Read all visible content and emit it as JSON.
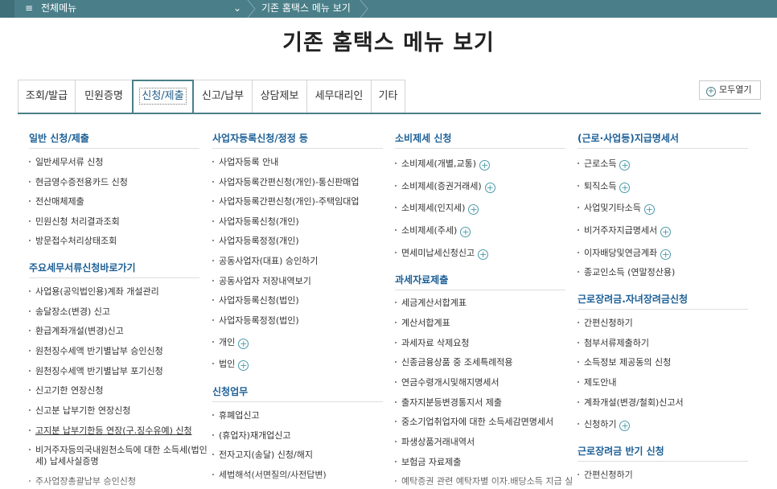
{
  "topbar": {
    "hamburger": "≡",
    "menu_all": "전체메뉴",
    "chevron": "⌄",
    "breadcrumb": "기존 홈택스 메뉴 보기"
  },
  "page_title": "기존 홈택스 메뉴 보기",
  "tabs": [
    {
      "label": "조회/발급"
    },
    {
      "label": "민원증명"
    },
    {
      "label": "신청/제출",
      "active": true
    },
    {
      "label": "신고/납부"
    },
    {
      "label": "상담제보"
    },
    {
      "label": "세무대리인"
    },
    {
      "label": "기타"
    }
  ],
  "expand_all": "모두열기",
  "columns": {
    "c1": {
      "h1": "일반 신청/제출",
      "g1": [
        "일반세무서류 신청",
        "현금영수증전용카드 신청",
        "전산매체제출",
        "민원신청 처리결과조회",
        "방문접수처리상태조회"
      ],
      "h2": "주요세무서류신청바로가기",
      "g2": [
        "사업용(공익법인용)계좌 개설관리",
        "송달장소(변경) 신고",
        "환급계좌개설(변경)신고",
        "원천징수세액 반기별납부 승인신청",
        "원천징수세액 반기별납부 포기신청",
        "신고기한 연장신청",
        "신고분 납부기한 연장신청",
        "고지분 납부기한등 연장(구.징수유예) 신청"
      ],
      "g2_last_l1": "비거주자등의국내원천소득에 대한 소득세(법인",
      "g2_last_l2": "세) 납세사실증명",
      "g2_tail": "주사업장총괄납부 승인신청"
    },
    "c2": {
      "h1": "사업자등록신청/정정 등",
      "g1": [
        "사업자등록 안내",
        "사업자등록간편신청(개인)-통신판매업",
        "사업자등록간편신청(개인)-주택임대업",
        "사업자등록신청(개인)",
        "사업자등록정정(개인)",
        "공동사업자(대표) 승인하기",
        "공동사업자 저장내역보기",
        "사업자등록신청(법인)",
        "사업자등록정정(법인)",
        "개인",
        "법인"
      ],
      "h2": "신청업무",
      "g2": [
        "휴폐업신고",
        "(휴업자)재개업신고",
        "전자고지(송달) 신청/해지",
        "세법해석(서면질의/사전답변)"
      ]
    },
    "c3": {
      "h1": "소비제세 신청",
      "g1": [
        "소비제세(개별,교통)",
        "소비제세(증권거래세)",
        "소비제세(인지세)",
        "소비제세(주세)",
        "면세미납세신청신고"
      ],
      "h2": "과세자료제출",
      "g2": [
        "세금계산서합계표",
        "계산서합계표",
        "과세자료 삭제요청",
        "신종금융상품 중 조세특례적용",
        "연금수령개시및해지명세서",
        "출자지분등변경통지서 제출",
        "중소기업취업자에 대한 소득세감면명세서",
        "파생상품거래내역서",
        "보험금 자료제출",
        "예탁증권 관련 예탁자별 이자.배당소득 지급 실"
      ]
    },
    "c4": {
      "h1": "(근로·사업등)지급명세서",
      "g1": [
        "근로소득",
        "퇴직소득",
        "사업및기타소득",
        "비거주자지급명세서",
        "이자배당및연금계좌",
        "종교인소득 (연말정산용)"
      ],
      "h2": "근로장려금.자녀장려금신청",
      "g2": [
        "간편신청하기",
        "첨부서류제출하기",
        "소득정보 제공동의 신청",
        "제도안내",
        "계좌개설(변경/철회)신고서",
        "신청하기"
      ],
      "h3": "근로장려금 반기 신청",
      "g3": [
        "간편신청하기"
      ]
    }
  },
  "plus_glyph": "+",
  "accent_color": "#4a7f89",
  "heading_color": "#1c5f96"
}
